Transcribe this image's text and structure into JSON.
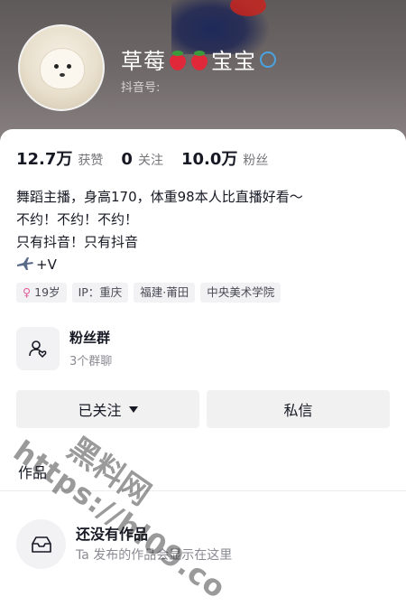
{
  "profile": {
    "name_prefix": "草莓",
    "name_suffix": "宝宝",
    "id_label": "抖音号:"
  },
  "stats": [
    {
      "value": "12.7万",
      "label": "获赞"
    },
    {
      "value": "0",
      "label": "关注"
    },
    {
      "value": "10.0万",
      "label": "粉丝"
    }
  ],
  "bio": {
    "line1": "舞蹈主播，身高170，体重98本人比直播好看～",
    "line2": "不约！不约！不约！",
    "line3": "只有抖音！只有抖音",
    "line4": "+V"
  },
  "tags": [
    {
      "icon": "female-symbol",
      "label": "19岁"
    },
    {
      "label": "IP：重庆"
    },
    {
      "label": "福建·莆田"
    },
    {
      "label": "中央美术学院"
    }
  ],
  "fan_group": {
    "title": "粉丝群",
    "subtitle": "3个群聊"
  },
  "actions": {
    "follow_label": "已关注",
    "message_label": "私信"
  },
  "tabs": {
    "works_label": "作品"
  },
  "empty_state": {
    "title": "还没有作品",
    "subtitle": "Ta 发布的作品会显示在这里"
  },
  "watermark": {
    "line1": "https://hl09.co",
    "line2": "黑料网"
  },
  "colors": {
    "header_bg": "#6e6767",
    "tag_bg": "#f2f2f4",
    "button_bg": "#f1f1f2",
    "text_primary": "#161823",
    "text_secondary": "#75757a"
  }
}
